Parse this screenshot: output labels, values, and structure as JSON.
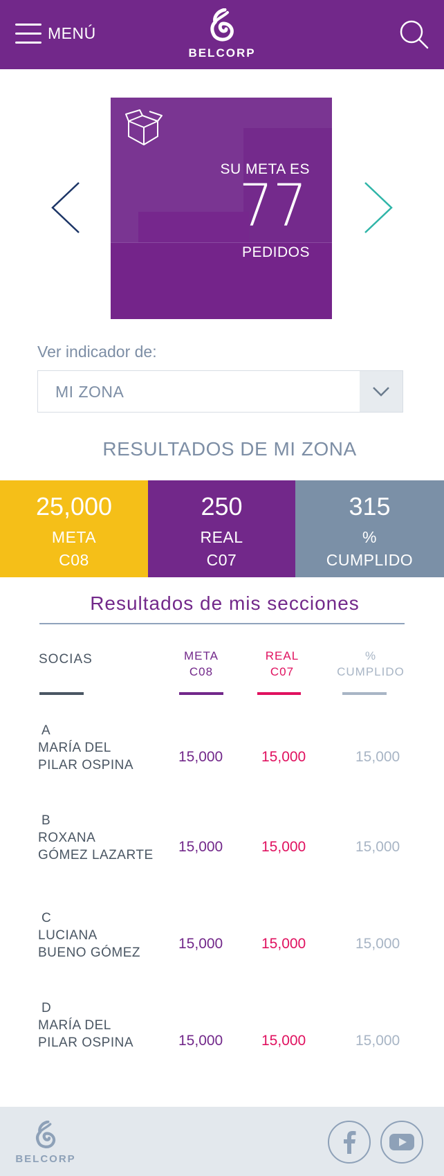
{
  "header": {
    "menu_label": "MENÚ",
    "brand": "BELCORP"
  },
  "goal_card": {
    "label": "SU META ES",
    "value": "77",
    "unit": "PEDIDOS"
  },
  "indicator": {
    "label": "Ver indicador de:",
    "selected": "MI ZONA"
  },
  "zone_results": {
    "title": "RESULTADOS DE MI ZONA",
    "stats": [
      {
        "value": "25,000",
        "line1": "META",
        "line2": "C08",
        "color": "#f5bf18"
      },
      {
        "value": "250",
        "line1": "REAL",
        "line2": "C07",
        "color": "#72288a"
      },
      {
        "value": "315",
        "line1": "%",
        "line2": "CUMPLIDO",
        "color": "#7b90a7"
      }
    ]
  },
  "sections": {
    "title": "Resultados de mis secciones",
    "headers": {
      "socias": "SOCIAS",
      "meta_1": "META",
      "meta_2": "C08",
      "real_1": "REAL",
      "real_2": "C07",
      "pct_1": "%",
      "pct_2": "CUMPLIDO"
    },
    "rows": [
      {
        "letter": "A",
        "name1": "MARÍA DEL",
        "name2": "PILAR OSPINA",
        "meta": "15,000",
        "real": "15,000",
        "pct": "15,000"
      },
      {
        "letter": "B",
        "name1": "ROXANA",
        "name2": "GÓMEZ LAZARTE",
        "meta": "15,000",
        "real": "15,000",
        "pct": "15,000"
      },
      {
        "letter": "C",
        "name1": "LUCIANA",
        "name2": "BUENO GÓMEZ",
        "meta": "15,000",
        "real": "15,000",
        "pct": "15,000"
      },
      {
        "letter": "D",
        "name1": "MARÍA DEL",
        "name2": "PILAR OSPINA",
        "meta": "15,000",
        "real": "15,000",
        "pct": "15,000"
      }
    ]
  },
  "footer": {
    "brand": "BELCORP",
    "social": [
      "facebook-icon",
      "youtube-icon"
    ]
  },
  "colors": {
    "brand_purple": "#72288a",
    "meta_yellow": "#f5bf18",
    "slate": "#7b90a7",
    "real_pink": "#e0115f",
    "arrow_navy": "#1c3566",
    "arrow_teal": "#2fb5a8"
  }
}
